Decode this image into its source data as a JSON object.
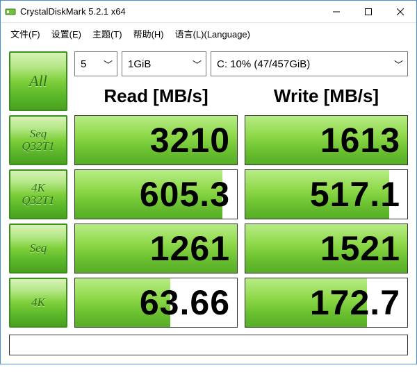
{
  "window": {
    "title": "CrystalDiskMark 5.2.1 x64"
  },
  "menu": {
    "file": "文件(F)",
    "settings": "设置(E)",
    "theme": "主题(T)",
    "help": "帮助(H)",
    "language": "语言(L)(Language)"
  },
  "controls": {
    "runs": "5",
    "size": "1GiB",
    "drive": "C: 10% (47/457GiB)"
  },
  "buttons": {
    "all": "All",
    "seq_q32t1_a": "Seq",
    "seq_q32t1_b": "Q32T1",
    "k4_q32t1_a": "4K",
    "k4_q32t1_b": "Q32T1",
    "seq": "Seq",
    "k4": "4K"
  },
  "headers": {
    "read": "Read [MB/s]",
    "write": "Write [MB/s]"
  },
  "results": {
    "seq_q32t1": {
      "read": "3210",
      "read_fill": 100,
      "write": "1613",
      "write_fill": 100
    },
    "k4_q32t1": {
      "read": "605.3",
      "read_fill": 91,
      "write": "517.1",
      "write_fill": 89
    },
    "seq": {
      "read": "1261",
      "read_fill": 100,
      "write": "1521",
      "write_fill": 100
    },
    "k4": {
      "read": "63.66",
      "read_fill": 59,
      "write": "172.7",
      "write_fill": 75
    }
  },
  "status": ""
}
